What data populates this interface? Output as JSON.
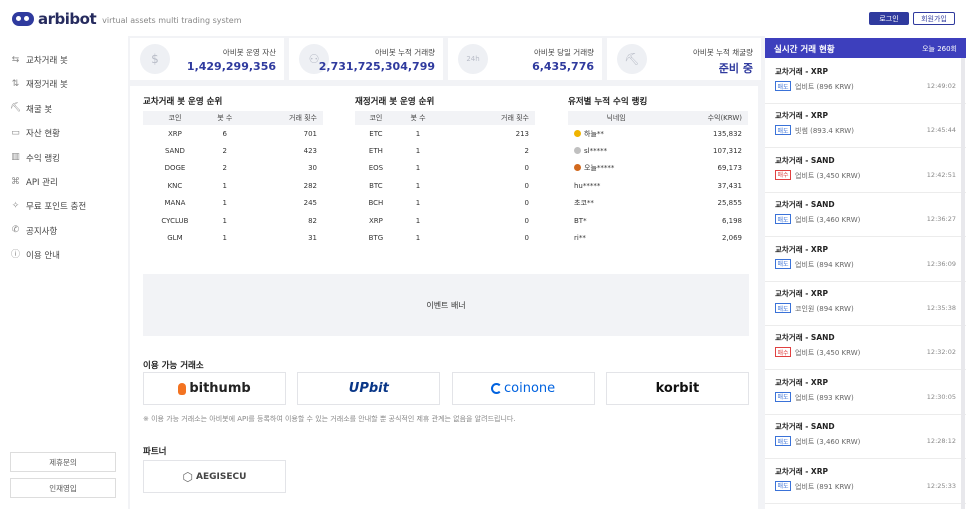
{
  "header": {
    "logo_text": "arbibot",
    "subtitle": "virtual assets multi trading system",
    "login_label": "로그인",
    "join_label": "회원가입"
  },
  "sidebar": {
    "items": [
      {
        "label": "교차거래 봇",
        "icon": "exchange-icon",
        "glyph": "⇆"
      },
      {
        "label": "재정거래 봇",
        "icon": "arbitrage-icon",
        "glyph": "⇅"
      },
      {
        "label": "채굴 봇",
        "icon": "pickaxe-icon",
        "glyph": "⛏"
      },
      {
        "label": "자산 현황",
        "icon": "wallet-icon",
        "glyph": "▭"
      },
      {
        "label": "수익 랭킹",
        "icon": "bar-chart-icon",
        "glyph": "▥"
      },
      {
        "label": "API 관리",
        "icon": "api-icon",
        "glyph": "⌘"
      },
      {
        "label": "무료 포인트 충전",
        "icon": "gift-icon",
        "glyph": "✧"
      },
      {
        "label": "공지사항",
        "icon": "megaphone-icon",
        "glyph": "✆"
      },
      {
        "label": "이용 안내",
        "icon": "info-icon",
        "glyph": "ⓘ"
      }
    ],
    "partnership_label": "제휴문의",
    "recruit_label": "인재영입"
  },
  "stats": [
    {
      "label": "아비봇 운영 자산",
      "value": "1,429,299,356",
      "icon": "coins-icon",
      "glyph": "$"
    },
    {
      "label": "아비봇 누적 거래량",
      "value": "2,731,725,304,799",
      "icon": "chart-icon",
      "glyph": "⚇"
    },
    {
      "label": "아비봇 당일 거래량",
      "value": "6,435,776",
      "icon": "clock-24h-icon",
      "glyph": "24h"
    },
    {
      "label": "아비봇 누적 채굴량",
      "value": "준비 중",
      "icon": "mining-icon",
      "glyph": "⛏"
    }
  ],
  "cross_bot": {
    "title": "교차거래 봇 운영 순위",
    "headers": [
      "코인",
      "봇 수",
      "거래 횟수"
    ],
    "rows": [
      [
        "XRP",
        "6",
        "701"
      ],
      [
        "SAND",
        "2",
        "423"
      ],
      [
        "DOGE",
        "2",
        "30"
      ],
      [
        "KNC",
        "1",
        "282"
      ],
      [
        "MANA",
        "1",
        "245"
      ],
      [
        "CYCLUB",
        "1",
        "82"
      ],
      [
        "GLM",
        "1",
        "31"
      ]
    ]
  },
  "arb_bot": {
    "title": "재정거래 봇 운영 순위",
    "headers": [
      "코인",
      "봇 수",
      "거래 횟수"
    ],
    "rows": [
      [
        "ETC",
        "1",
        "213"
      ],
      [
        "ETH",
        "1",
        "2"
      ],
      [
        "EOS",
        "1",
        "0"
      ],
      [
        "BTC",
        "1",
        "0"
      ],
      [
        "BCH",
        "1",
        "0"
      ],
      [
        "XRP",
        "1",
        "0"
      ],
      [
        "BTG",
        "1",
        "0"
      ]
    ]
  },
  "user_rank": {
    "title": "유저별 누적 수익 랭킹",
    "headers": [
      "닉네임",
      "수익(KRW)"
    ],
    "rows": [
      {
        "nick": "하늘**",
        "profit": "135,832",
        "medal": "#f0b400"
      },
      {
        "nick": "sl*****",
        "profit": "107,312",
        "medal": "#c0c0c0"
      },
      {
        "nick": "오늘*****",
        "profit": "69,173",
        "medal": "#d2691e"
      },
      {
        "nick": "hu*****",
        "profit": "37,431",
        "medal": ""
      },
      {
        "nick": "초코**",
        "profit": "25,855",
        "medal": ""
      },
      {
        "nick": "BT*",
        "profit": "6,198",
        "medal": ""
      },
      {
        "nick": "ri**",
        "profit": "2,069",
        "medal": ""
      }
    ]
  },
  "banner_label": "이벤트 배너",
  "exchanges": {
    "title": "이용 가능 거래소",
    "items": [
      {
        "name": "bithumb",
        "color": "#222",
        "accent": "#f37321"
      },
      {
        "name": "UPbit",
        "color": "#093687",
        "accent": "#093687"
      },
      {
        "name": "coinone",
        "color": "#0062df",
        "accent": "#0062df"
      },
      {
        "name": "korbit",
        "color": "#111",
        "accent": "#111"
      }
    ],
    "note": "※ 이용 가능 거래소는 아비봇에 API를 등록하여 이용할 수 있는 거래소를 안내할 뿐 공식적인 제휴 관계는 없음을 알려드립니다."
  },
  "partners": {
    "title": "파트너",
    "items": [
      {
        "name": "AEGISECU"
      }
    ]
  },
  "live": {
    "title": "실시간 거래 현황",
    "count": "오늘 260회",
    "items": [
      {
        "title": "교차거래 - XRP",
        "badge": "매도",
        "type": "sell",
        "desc": "업비트 (896 KRW)",
        "time": "12:49:02"
      },
      {
        "title": "교차거래 - XRP",
        "badge": "매도",
        "type": "sell",
        "desc": "빗썸 (893.4 KRW)",
        "time": "12:45:44"
      },
      {
        "title": "교차거래 - SAND",
        "badge": "매수",
        "type": "buy",
        "desc": "업비트 (3,450 KRW)",
        "time": "12:42:51"
      },
      {
        "title": "교차거래 - SAND",
        "badge": "매도",
        "type": "sell",
        "desc": "업비트 (3,460 KRW)",
        "time": "12:36:27"
      },
      {
        "title": "교차거래 - XRP",
        "badge": "매도",
        "type": "sell",
        "desc": "업비트 (894 KRW)",
        "time": "12:36:09"
      },
      {
        "title": "교차거래 - XRP",
        "badge": "매도",
        "type": "sell",
        "desc": "코인원 (894 KRW)",
        "time": "12:35:38"
      },
      {
        "title": "교차거래 - SAND",
        "badge": "매수",
        "type": "buy",
        "desc": "업비트 (3,450 KRW)",
        "time": "12:32:02"
      },
      {
        "title": "교차거래 - XRP",
        "badge": "매도",
        "type": "sell",
        "desc": "업비트 (893 KRW)",
        "time": "12:30:05"
      },
      {
        "title": "교차거래 - SAND",
        "badge": "매도",
        "type": "sell",
        "desc": "업비트 (3,460 KRW)",
        "time": "12:28:12"
      },
      {
        "title": "교차거래 - XRP",
        "badge": "매도",
        "type": "sell",
        "desc": "업비트 (891 KRW)",
        "time": "12:25:33"
      }
    ]
  }
}
